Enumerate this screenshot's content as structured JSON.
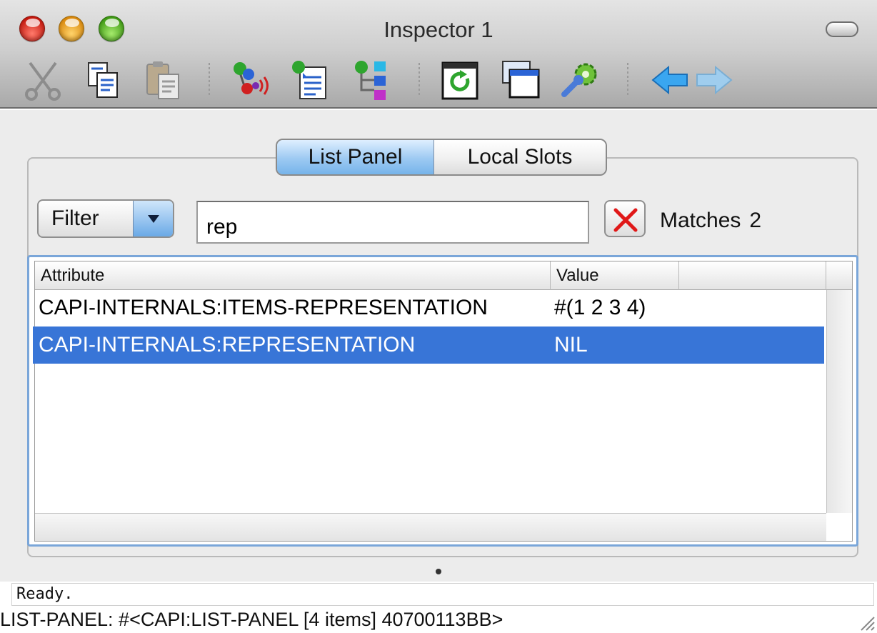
{
  "window": {
    "title": "Inspector 1",
    "controls": [
      "close",
      "minimize",
      "zoom"
    ]
  },
  "toolbar": {
    "items": [
      {
        "name": "cut",
        "icon": "scissors-icon",
        "enabled": false
      },
      {
        "name": "copy",
        "icon": "copy-icon",
        "enabled": true
      },
      {
        "name": "paste",
        "icon": "paste-icon",
        "enabled": false
      },
      {
        "name": "inspect-object",
        "icon": "inspect-object-icon",
        "enabled": true
      },
      {
        "name": "inspect-list",
        "icon": "inspect-list-icon",
        "enabled": true
      },
      {
        "name": "inspect-tree",
        "icon": "inspect-tree-icon",
        "enabled": true
      },
      {
        "name": "refresh",
        "icon": "refresh-icon",
        "enabled": true
      },
      {
        "name": "new-window",
        "icon": "window-icon",
        "enabled": true
      },
      {
        "name": "preferences",
        "icon": "wrench-gear-icon",
        "enabled": true
      },
      {
        "name": "back",
        "icon": "arrow-left-icon",
        "enabled": true
      },
      {
        "name": "forward",
        "icon": "arrow-right-icon",
        "enabled": false
      }
    ]
  },
  "tabs": [
    {
      "label": "List Panel",
      "selected": true
    },
    {
      "label": "Local Slots",
      "selected": false
    }
  ],
  "filter": {
    "mode_label": "Filter",
    "query": "rep",
    "matches_label": "Matches",
    "matches_count": "2"
  },
  "table": {
    "columns": [
      "Attribute",
      "Value",
      ""
    ],
    "rows": [
      {
        "attribute": "CAPI-INTERNALS:ITEMS-REPRESENTATION",
        "value": "#(1 2 3 4)",
        "selected": false
      },
      {
        "attribute": "CAPI-INTERNALS:REPRESENTATION",
        "value": "NIL",
        "selected": true
      }
    ]
  },
  "status": {
    "message": "Ready.",
    "description": "LIST-PANEL: #<CAPI:LIST-PANEL [4 items] 40700113BB>"
  },
  "colors": {
    "selection": "#3875d7",
    "tab_selected": "#9cc9f2",
    "focus_ring": "#7aa6d9"
  }
}
